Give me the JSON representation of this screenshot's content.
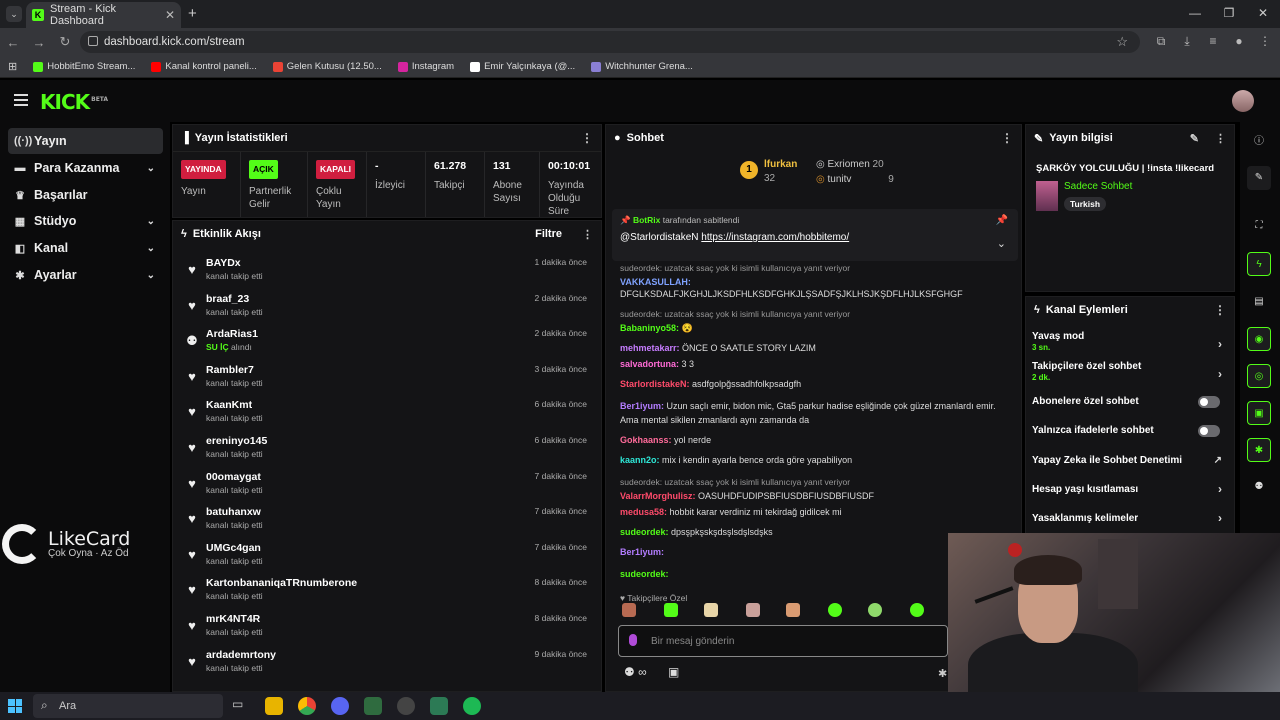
{
  "browser": {
    "tab_title": "Stream - Kick Dashboard",
    "url": "dashboard.kick.com/stream",
    "bookmarks": [
      {
        "label": "HobbitEmo Stream...",
        "color": "#53fc18"
      },
      {
        "label": "Kanal kontrol paneli...",
        "color": "#ff0000"
      },
      {
        "label": "Gelen Kutusu (12.50...",
        "color": "#ea4335"
      },
      {
        "label": "Instagram",
        "color": "#d6249f"
      },
      {
        "label": "Emir Yalçınkaya (@...",
        "color": "#ffffff"
      },
      {
        "label": "Witchhunter Grena...",
        "color": "#8a7fd4"
      }
    ]
  },
  "header": {
    "logo": "KICK",
    "logo_tag": "BETA"
  },
  "sidebar": {
    "items": [
      {
        "label": "Yayın",
        "icon": "broadcast-icon",
        "glyph": "((·))",
        "chev": ""
      },
      {
        "label": "Para Kazanma",
        "icon": "money-icon",
        "glyph": "▬",
        "chev": "⌄"
      },
      {
        "label": "Başarılar",
        "icon": "trophy-icon",
        "glyph": "♛",
        "chev": ""
      },
      {
        "label": "Stüdyo",
        "icon": "studio-icon",
        "glyph": "▦",
        "chev": "⌄"
      },
      {
        "label": "Kanal",
        "icon": "channel-icon",
        "glyph": "◧",
        "chev": "⌄"
      },
      {
        "label": "Ayarlar",
        "icon": "gear-icon",
        "glyph": "✱",
        "chev": "⌄"
      }
    ]
  },
  "stats": {
    "title": "Yayın İstatistikleri",
    "cards": [
      {
        "badge": "YAYINDA",
        "badge_class": "b-red",
        "value": "",
        "label": "Yayın"
      },
      {
        "badge": "AÇIK",
        "badge_class": "b-green",
        "value": "",
        "label": "Partnerlik Gelir"
      },
      {
        "badge": "KAPALI",
        "badge_class": "b-red",
        "value": "",
        "label": "Çoklu Yayın"
      },
      {
        "badge": "",
        "badge_class": "",
        "value": "-",
        "label": "İzleyici"
      },
      {
        "badge": "",
        "badge_class": "",
        "value": "61.278",
        "label": "Takipçi"
      },
      {
        "badge": "",
        "badge_class": "",
        "value": "131",
        "label": "Abone Sayısı"
      },
      {
        "badge": "",
        "badge_class": "",
        "value": "00:10:01",
        "label": "Yayında Olduğu Süre"
      }
    ]
  },
  "activity": {
    "title": "Etkinlik Akışı",
    "filter_label": "Filtre",
    "items": [
      {
        "name": "BAYDx",
        "pre": "",
        "sub": "kanalı takip etti",
        "time": "1 dakika önce",
        "icon": "heart-icon"
      },
      {
        "name": "braaf_23",
        "pre": "",
        "sub": "kanalı takip etti",
        "time": "2 dakika önce",
        "icon": "heart-icon"
      },
      {
        "name": "ArdaRias1",
        "pre": "SU İÇ",
        "sub": " alındı",
        "time": "2 dakika önce",
        "icon": "redeem-icon"
      },
      {
        "name": "Rambler7",
        "pre": "",
        "sub": "kanalı takip etti",
        "time": "3 dakika önce",
        "icon": "heart-icon"
      },
      {
        "name": "KaanKmt",
        "pre": "",
        "sub": "kanalı takip etti",
        "time": "6 dakika önce",
        "icon": "heart-icon"
      },
      {
        "name": "ereninyo145",
        "pre": "",
        "sub": "kanalı takip etti",
        "time": "6 dakika önce",
        "icon": "heart-icon"
      },
      {
        "name": "00omaygat",
        "pre": "",
        "sub": "kanalı takip etti",
        "time": "7 dakika önce",
        "icon": "heart-icon"
      },
      {
        "name": "batuhanxw",
        "pre": "",
        "sub": "kanalı takip etti",
        "time": "7 dakika önce",
        "icon": "heart-icon"
      },
      {
        "name": "UMGc4gan",
        "pre": "",
        "sub": "kanalı takip etti",
        "time": "7 dakika önce",
        "icon": "heart-icon"
      },
      {
        "name": "KartonbananiqaTRnumberone",
        "pre": "",
        "sub": "kanalı takip etti",
        "time": "8 dakika önce",
        "icon": "heart-icon"
      },
      {
        "name": "mrK4NT4R",
        "pre": "",
        "sub": "kanalı takip etti",
        "time": "8 dakika önce",
        "icon": "heart-icon"
      },
      {
        "name": "ardademrtony",
        "pre": "",
        "sub": "kanalı takip etti",
        "time": "9 dakika önce",
        "icon": "heart-icon"
      }
    ]
  },
  "chat": {
    "title": "Sohbet",
    "leader1": {
      "rank": "1",
      "name": "lfurkan",
      "count": "32"
    },
    "leader2": {
      "name": "Exriomen",
      "count": "20"
    },
    "leader3": {
      "name": "tunitv",
      "count": "9"
    },
    "pinned_by_user": "BotRix",
    "pinned_by_text": "tarafından sabitlendi",
    "pinned_mention": "@StarlordistakeN",
    "pinned_link": "https://instagram.com/hobbitemo/",
    "messages": [
      {
        "reply": "sudeordek: uzatcak ssaç yok ki isimli kullanıcıya yanıt veriyor",
        "user": "",
        "color": "#fff",
        "text": ""
      },
      {
        "reply": "",
        "user": "VAKKASULLAH:",
        "color": "#7fa2ff",
        "text": ""
      },
      {
        "reply": "",
        "user": "",
        "color": "#fff",
        "text": "DFGLKSDALFJKGHJLJKSDFHLKSDFGHKJLŞSADFŞJKLHSJKŞDFLHJLKSFGHGF"
      },
      {
        "reply": "sudeordek: uzatcak ssaç yok ki isimli kullanıcıya yanıt veriyor",
        "user": "",
        "color": "#fff",
        "text": ""
      },
      {
        "reply": "",
        "user": "Babaninyo58:",
        "color": "#53fc18",
        "text": "😵"
      },
      {
        "reply": "",
        "user": "mehmetakarr:",
        "color": "#c77dff",
        "text": "ÖNCE O SAATLE STORY LAZIM"
      },
      {
        "reply": "",
        "user": "salvadortuna:",
        "color": "#ff6bd5",
        "text": "3 3"
      },
      {
        "reply": "",
        "user": "StarlordistakeN:",
        "color": "#ff4b6b",
        "text": "asdfgolpğssadhfolkpsadgfh"
      },
      {
        "reply": "",
        "user": "Ber1iyum:",
        "color": "#b37dff",
        "text": "Uzun saçlı emir, bidon mic, Gta5 parkur hadise eşliğinde çok güzel zmanlardı emir. Ama mental sikilen zmanlardı aynı zamanda da"
      },
      {
        "reply": "",
        "user": "Gokhaanss:",
        "color": "#ff6b9a",
        "text": "yol nerde"
      },
      {
        "reply": "",
        "user": "kaann2o:",
        "color": "#2ee6d6",
        "text": "mix i kendin ayarla bence orda göre yapabiliyon"
      },
      {
        "reply": "sudeordek: uzatcak ssaç yok ki isimli kullanıcıya yanıt veriyor",
        "user": "ValarrMorghulisz:",
        "color": "#ff4b6b",
        "text": "OASUHDFUDIPSBFIUSDBFIUSDBFIUSDF"
      },
      {
        "reply": "",
        "user": "medusa58:",
        "color": "#ff4b6b",
        "text": "hobbit karar verdiniz mi tekirdağ gidilcek mi"
      },
      {
        "reply": "",
        "user": "sudeordek:",
        "color": "#53fc18",
        "text": "dpsşpkşskşdsşlsdşlsdşks"
      },
      {
        "reply": "",
        "user": "Ber1iyum:",
        "color": "#b37dff",
        "text": ""
      },
      {
        "reply": "",
        "user": "sudeordek:",
        "color": "#53fc18",
        "text": ""
      }
    ],
    "followers_only": "Takipçilere Özel",
    "input_placeholder": "Bir mesaj gönderin"
  },
  "stream_info": {
    "title": "Yayın bilgisi",
    "stream_title": "ŞARKÖY YOLCULUĞU | !insta !likecard",
    "category": "Sadece Sohbet",
    "language": "Turkish"
  },
  "channel_actions": {
    "title": "Kanal Eylemleri",
    "rows": [
      {
        "label": "Yavaş mod",
        "sub": "3 sn.",
        "kind": "arrow"
      },
      {
        "label": "Takipçilere özel sohbet",
        "sub": "2 dk.",
        "kind": "arrow"
      },
      {
        "label": "Abonelere özel sohbet",
        "sub": "",
        "kind": "toggle"
      },
      {
        "label": "Yalnızca ifadelerle sohbet",
        "sub": "",
        "kind": "toggle"
      },
      {
        "label": "Yapay Zeka ile Sohbet Denetimi",
        "sub": "",
        "kind": "external"
      },
      {
        "label": "Hesap yaşı kısıtlaması",
        "sub": "",
        "kind": "arrow"
      },
      {
        "label": "Yasaklanmış kelimeler",
        "sub": "",
        "kind": "arrow"
      }
    ]
  },
  "overlay": {
    "brand": "LikeCard",
    "slogan": "Çok Oyna · Az Öd"
  },
  "taskbar": {
    "search_placeholder": "Ara"
  }
}
